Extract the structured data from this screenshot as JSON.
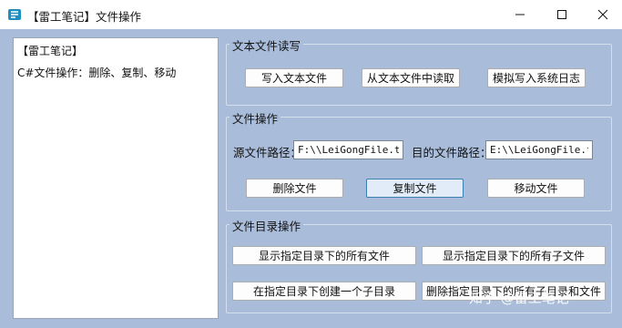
{
  "window": {
    "title": "【雷工笔记】文件操作"
  },
  "log": {
    "lines": [
      "【雷工笔记】",
      "C#文件操作：删除、复制、移动"
    ]
  },
  "groups": {
    "text_rw": {
      "title": "文本文件读写",
      "write_label": "写入文本文件",
      "read_label": "从文本文件中读取",
      "log_label": "模拟写入系统日志"
    },
    "file_ops": {
      "title": "文件操作",
      "source_label": "源文件路径：",
      "source_value": "F:\\\\LeiGongFile.txt",
      "target_label": "目的文件路径：",
      "target_value": "E:\\\\LeiGongFile.txt",
      "delete_label": "删除文件",
      "copy_label": "复制文件",
      "move_label": "移动文件"
    },
    "dir_ops": {
      "title": "文件目录操作",
      "list_files_label": "显示指定目录下的所有文件",
      "list_subdirs_label": "显示指定目录下的所有子文件",
      "create_dir_label": "在指定目录下创建一个子目录",
      "delete_all_label": "删除指定目录下的所有子目录和文件"
    }
  },
  "watermark": "知乎 @雷工笔记",
  "colors": {
    "background": "#a9bcd9",
    "focus_border": "#3c7fb1"
  }
}
